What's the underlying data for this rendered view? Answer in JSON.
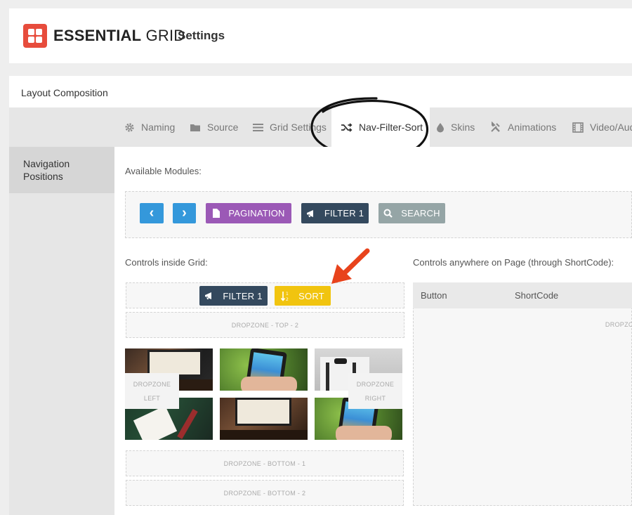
{
  "header": {
    "brand_bold": "ESSENTIAL",
    "brand_light": "GRID",
    "page_title": "Settings"
  },
  "section": {
    "title": "Layout Composition"
  },
  "tabs": [
    {
      "label": "Naming",
      "icon": "gear-icon"
    },
    {
      "label": "Source",
      "icon": "folder-icon"
    },
    {
      "label": "Grid Settings",
      "icon": "menu-icon"
    },
    {
      "label": "Nav-Filter-Sort",
      "icon": "shuffle-icon",
      "active": true
    },
    {
      "label": "Skins",
      "icon": "drop-icon"
    },
    {
      "label": "Animations",
      "icon": "tools-icon"
    },
    {
      "label": "Video/Aud",
      "icon": "film-icon"
    }
  ],
  "sidebar": {
    "item": "Navigation Positions"
  },
  "main": {
    "available_label": "Available Modules:",
    "modules": {
      "prev": "‹",
      "next": "›",
      "pagination": "PAGINATION",
      "filter": "FILTER 1",
      "search": "SEARCH"
    },
    "inside_grid_label": "Controls inside Grid:",
    "anywhere_label": "Controls anywhere on Page (through ShortCode):",
    "top_controls": {
      "filter": "FILTER 1",
      "sort": "SORT"
    },
    "dropzones": {
      "top2": "DROPZONE - TOP - 2",
      "left_1": "DROPZONE",
      "left_2": "LEFT",
      "right_1": "DROPZONE",
      "right_2": "RIGHT",
      "bottom1": "DROPZONE - BOTTOM - 1",
      "bottom2": "DROPZONE - BOTTOM - 2",
      "shortcode_zone": "DROPZON"
    },
    "shortcode_table": {
      "col_button": "Button",
      "col_shortcode": "ShortCode"
    }
  },
  "colors": {
    "accent_red": "#e74c3c",
    "blue": "#3498db",
    "purple": "#9b59b6",
    "dark": "#34495e",
    "gray": "#95a5a6",
    "yellow": "#f1c40f",
    "arrow": "#e8431c"
  }
}
